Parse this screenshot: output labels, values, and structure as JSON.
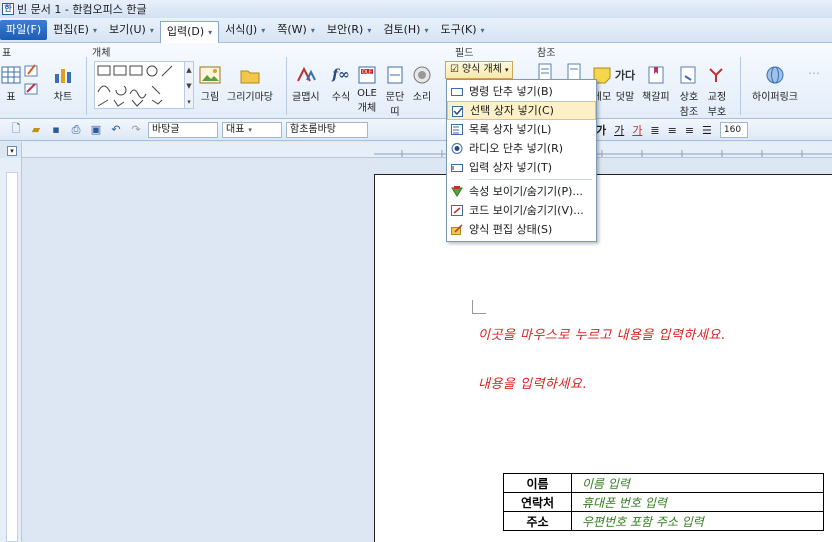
{
  "window": {
    "title": "빈 문서 1 - 한컴오피스 한글"
  },
  "menubar": {
    "file": "파일(F)",
    "items": [
      {
        "label": "편집(E)"
      },
      {
        "label": "보기(U)"
      },
      {
        "label": "입력(D)"
      },
      {
        "label": "서식(J)"
      },
      {
        "label": "쪽(W)"
      },
      {
        "label": "보안(R)"
      },
      {
        "label": "검토(H)"
      },
      {
        "label": "도구(K)"
      }
    ]
  },
  "ribbon": {
    "groups": {
      "table": "표",
      "object": "개체",
      "field": "필드",
      "reference": "참조"
    },
    "buttons": {
      "table": "표",
      "chart": "차트",
      "picture": "그림",
      "drawing_market": "그리기마당",
      "glyph": "글맵시",
      "equation": "수식",
      "ole": "OLE",
      "ole2": "개체",
      "paragraph": "문단",
      "paragraph2": "띠",
      "sound": "소리",
      "form_object": "양식 개체",
      "memo": "메모",
      "footnote": "덧말",
      "bookmark": "책갈피",
      "cross_ref": "상호",
      "cross_ref2": "참조",
      "proof": "교정",
      "proof2": "부호",
      "hyperlink": "하이퍼링크",
      "ga_da": "가다"
    }
  },
  "toolbar": {
    "style_combo": "바탕글",
    "lang_combo": "대표",
    "font_combo": "함초롬바탕",
    "font_size": "160",
    "char_buttons": [
      "가",
      "가",
      "가"
    ]
  },
  "dropdown": {
    "items": [
      {
        "label": "명령 단추 넣기(B)",
        "icon": "command-button-icon"
      },
      {
        "label": "선택 상자 넣기(C)",
        "icon": "checkbox-icon",
        "highlighted": true
      },
      {
        "label": "목록 상자 넣기(L)",
        "icon": "listbox-icon"
      },
      {
        "label": "라디오 단추 넣기(R)",
        "icon": "radio-icon"
      },
      {
        "label": "입력 상자 넣기(T)",
        "icon": "input-box-icon"
      },
      {
        "label": "속성 보이기/숨기기(P)...",
        "icon": "property-icon"
      },
      {
        "label": "코드 보이기/숨기기(V)...",
        "icon": "code-icon"
      },
      {
        "label": "양식 편집 상태(S)",
        "icon": "form-edit-icon"
      }
    ]
  },
  "document": {
    "placeholder1": "이곳을 마우스로 누르고 내용을 입력하세요.",
    "placeholder2": "내용을 입력하세요.",
    "table": [
      {
        "label": "이름",
        "value": "이름 입력"
      },
      {
        "label": "연락처",
        "value": "휴대폰 번호 입력"
      },
      {
        "label": "주소",
        "value": "우편번호 포함 주소 입력"
      }
    ]
  },
  "colors": {
    "placeholder_text": "#e02020",
    "table_value_text": "#2e7d1a",
    "highlight_bg": "#fdf0c8"
  }
}
